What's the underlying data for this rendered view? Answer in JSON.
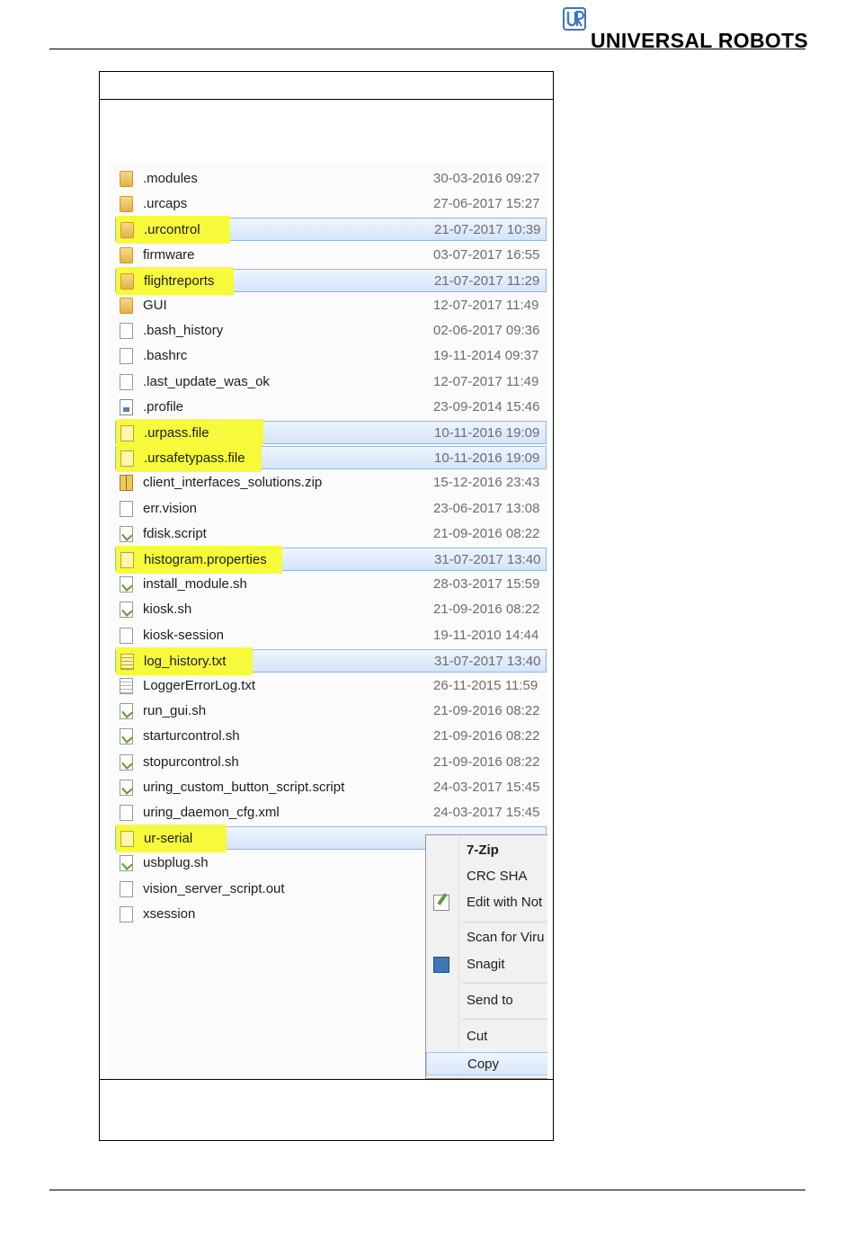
{
  "brand": {
    "logo_text": "UNIVERSAL ROBOTS",
    "mark_icon": "universal-robots-logo-icon"
  },
  "file_list": [
    {
      "name": ".modules",
      "date": "30-03-2016 09:27",
      "icon": "folder-icon",
      "selected": false,
      "highlighted": false
    },
    {
      "name": ".urcaps",
      "date": "27-06-2017 15:27",
      "icon": "folder-icon",
      "selected": false,
      "highlighted": false
    },
    {
      "name": ".urcontrol",
      "date": "21-07-2017 10:39",
      "icon": "folder-icon",
      "selected": true,
      "highlighted": true
    },
    {
      "name": "firmware",
      "date": "03-07-2017 16:55",
      "icon": "folder-icon",
      "selected": false,
      "highlighted": false
    },
    {
      "name": "flightreports",
      "date": "21-07-2017 11:29",
      "icon": "folder-icon",
      "selected": true,
      "highlighted": true
    },
    {
      "name": "GUI",
      "date": "12-07-2017 11:49",
      "icon": "folder-icon",
      "selected": false,
      "highlighted": false
    },
    {
      "name": ".bash_history",
      "date": "02-06-2017 09:36",
      "icon": "file-icon",
      "selected": false,
      "highlighted": false
    },
    {
      "name": ".bashrc",
      "date": "19-11-2014 09:37",
      "icon": "file-icon",
      "selected": false,
      "highlighted": false
    },
    {
      "name": ".last_update_was_ok",
      "date": "12-07-2017 11:49",
      "icon": "file-icon",
      "selected": false,
      "highlighted": false
    },
    {
      "name": ".profile",
      "date": "23-09-2014 15:46",
      "icon": "config-file-icon",
      "selected": false,
      "highlighted": false
    },
    {
      "name": ".urpass.file",
      "date": "10-11-2016 19:09",
      "icon": "file-icon",
      "selected": true,
      "highlighted": true
    },
    {
      "name": ".ursafetypass.file",
      "date": "10-11-2016 19:09",
      "icon": "file-icon",
      "selected": true,
      "highlighted": true
    },
    {
      "name": "client_interfaces_solutions.zip",
      "date": "15-12-2016 23:43",
      "icon": "zip-icon",
      "selected": false,
      "highlighted": false
    },
    {
      "name": "err.vision",
      "date": "23-06-2017 13:08",
      "icon": "file-icon",
      "selected": false,
      "highlighted": false
    },
    {
      "name": "fdisk.script",
      "date": "21-09-2016 08:22",
      "icon": "script-icon",
      "selected": false,
      "highlighted": false
    },
    {
      "name": "histogram.properties",
      "date": "31-07-2017 13:40",
      "icon": "file-icon",
      "selected": true,
      "highlighted": true
    },
    {
      "name": "install_module.sh",
      "date": "28-03-2017 15:59",
      "icon": "script-icon",
      "selected": false,
      "highlighted": false
    },
    {
      "name": "kiosk.sh",
      "date": "21-09-2016 08:22",
      "icon": "script-icon",
      "selected": false,
      "highlighted": false
    },
    {
      "name": "kiosk-session",
      "date": "19-11-2010 14:44",
      "icon": "file-icon",
      "selected": false,
      "highlighted": false
    },
    {
      "name": "log_history.txt",
      "date": "31-07-2017 13:40",
      "icon": "text-file-icon",
      "selected": true,
      "highlighted": true
    },
    {
      "name": "LoggerErrorLog.txt",
      "date": "26-11-2015 11:59",
      "icon": "text-file-icon",
      "selected": false,
      "highlighted": false
    },
    {
      "name": "run_gui.sh",
      "date": "21-09-2016 08:22",
      "icon": "script-icon",
      "selected": false,
      "highlighted": false
    },
    {
      "name": "starturcontrol.sh",
      "date": "21-09-2016 08:22",
      "icon": "script-icon",
      "selected": false,
      "highlighted": false
    },
    {
      "name": "stopurcontrol.sh",
      "date": "21-09-2016 08:22",
      "icon": "script-icon",
      "selected": false,
      "highlighted": false
    },
    {
      "name": "uring_custom_button_script.script",
      "date": "24-03-2017 15:45",
      "icon": "script-icon",
      "selected": false,
      "highlighted": false
    },
    {
      "name": "uring_daemon_cfg.xml",
      "date": "24-03-2017 15:45",
      "icon": "file-icon",
      "selected": false,
      "highlighted": false
    },
    {
      "name": "ur-serial",
      "date": "",
      "icon": "file-icon",
      "selected": true,
      "highlighted": true
    },
    {
      "name": "usbplug.sh",
      "date": "",
      "icon": "script-icon",
      "selected": false,
      "highlighted": false
    },
    {
      "name": "vision_server_script.out",
      "date": "",
      "icon": "file-icon",
      "selected": false,
      "highlighted": false
    },
    {
      "name": "xsession",
      "date": "",
      "icon": "file-icon",
      "selected": false,
      "highlighted": false
    }
  ],
  "context_menu": [
    {
      "label": "7-Zip",
      "bold": true,
      "icon": "",
      "hovered": false
    },
    {
      "label": "CRC SHA",
      "bold": false,
      "icon": "",
      "hovered": false
    },
    {
      "label": "Edit with Not",
      "bold": false,
      "icon": "notepad-icon",
      "hovered": false
    },
    {
      "label": "Scan for Viru",
      "bold": false,
      "icon": "",
      "hovered": false
    },
    {
      "label": "Snagit",
      "bold": false,
      "icon": "snagit-icon",
      "hovered": false
    },
    {
      "label": "Send to",
      "bold": false,
      "icon": "",
      "hovered": false
    },
    {
      "label": "Cut",
      "bold": false,
      "icon": "",
      "hovered": false
    },
    {
      "label": "Copy",
      "bold": false,
      "icon": "",
      "hovered": true
    }
  ],
  "colors": {
    "highlight": "#f6fa3a",
    "selection": "#d3e4f8",
    "date_text": "#6d6d6d"
  }
}
